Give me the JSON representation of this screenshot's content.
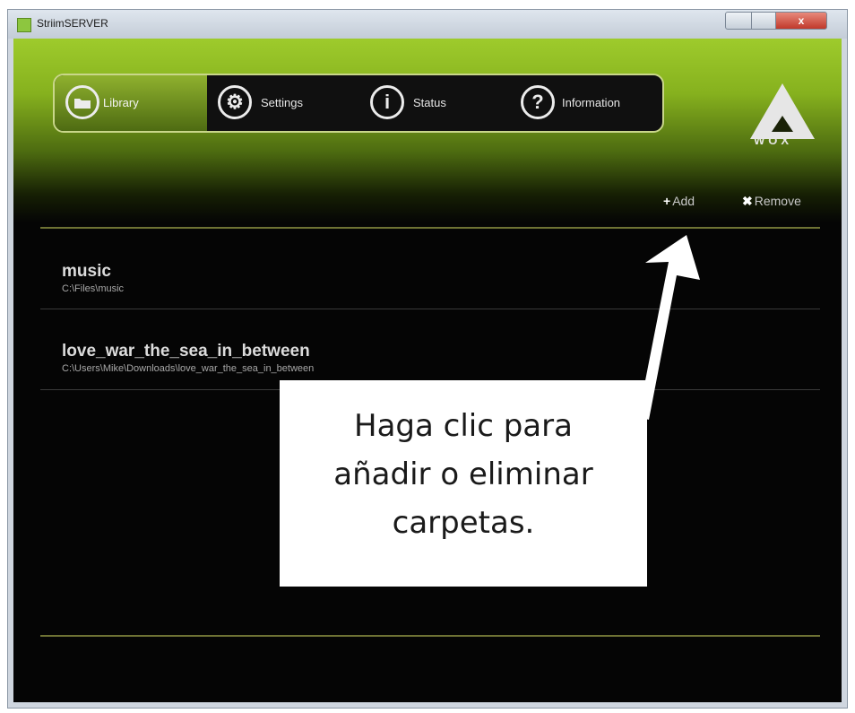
{
  "window": {
    "title": "StriimSERVER",
    "close_glyph": "x"
  },
  "nav": {
    "tabs": [
      {
        "label": "Library",
        "icon": "folder-icon",
        "active": true
      },
      {
        "label": "Settings",
        "icon": "gear-icon",
        "glyph": "⚙"
      },
      {
        "label": "Status",
        "icon": "info-icon",
        "glyph": "i"
      },
      {
        "label": "Information",
        "icon": "help-icon",
        "glyph": "?"
      }
    ]
  },
  "logo": {
    "text": "WOX"
  },
  "actions": {
    "add": {
      "glyph": "+",
      "label": "Add",
      "icon": "plus-icon"
    },
    "remove": {
      "glyph": "✖",
      "label": "Remove",
      "icon": "x-icon"
    }
  },
  "folders": [
    {
      "name": "music",
      "path": "C:\\Files\\music"
    },
    {
      "name": "love_war_the_sea_in_between",
      "path": "C:\\Users\\Mike\\Downloads\\love_war_the_sea_in_between"
    }
  ],
  "callout": {
    "lines": [
      "Haga clic para",
      "añadir o eliminar",
      "carpetas."
    ]
  },
  "colors": {
    "accent_green": "#8dc63f",
    "background": "#050505",
    "separator": "#6e7234"
  }
}
